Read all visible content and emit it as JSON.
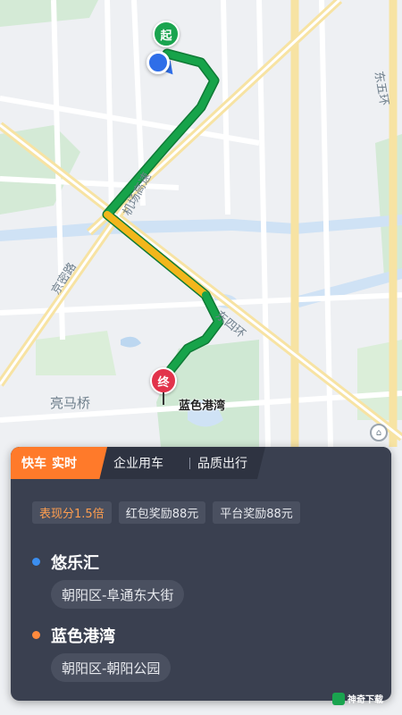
{
  "map": {
    "start_pin": "起",
    "end_pin": "终",
    "destination_label": "蓝色港湾",
    "road_labels": {
      "airport_expressway": "机场高速",
      "jingmi_road": "京密路",
      "east_fourth_ring": "东四环",
      "liangma_bridge": "亮马桥",
      "east_fifth_ring": "东五环"
    },
    "colors": {
      "route_green": "#17a34a",
      "route_yellow": "#f2b61c",
      "water": "#cfe2f5",
      "park": "#cfe8d3"
    }
  },
  "panel": {
    "tabs": [
      {
        "label": "快车",
        "sub": "实时"
      },
      {
        "label": "企业用车"
      },
      {
        "label": "品质出行"
      }
    ],
    "badges": [
      "表现分1.5倍",
      "红包奖励88元",
      "平台奖励88元"
    ],
    "stops": [
      {
        "name": "悠乐汇",
        "address": "朝阳区-阜通东大街",
        "dot_color": "#3b8ef0"
      },
      {
        "name": "蓝色港湾",
        "address": "朝阳区-朝阳公园",
        "dot_color": "#ff8a3d"
      }
    ]
  },
  "watermark": "神奇下载"
}
